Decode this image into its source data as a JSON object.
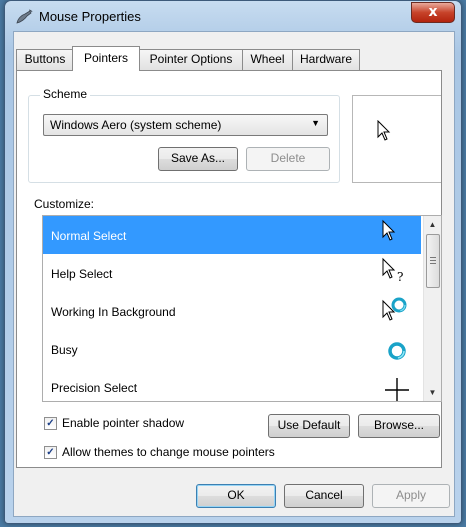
{
  "window": {
    "title": "Mouse Properties",
    "close_glyph": "x"
  },
  "tabs": [
    {
      "label": "Buttons"
    },
    {
      "label": "Pointers"
    },
    {
      "label": "Pointer Options"
    },
    {
      "label": "Wheel"
    },
    {
      "label": "Hardware"
    }
  ],
  "active_tab": "Pointers",
  "scheme": {
    "group_label": "Scheme",
    "selected": "Windows Aero (system scheme)",
    "save_as_label": "Save As...",
    "delete_label": "Delete"
  },
  "customize": {
    "label": "Customize:",
    "items": [
      {
        "label": "Normal Select",
        "icon": "arrow-cursor-icon"
      },
      {
        "label": "Help Select",
        "icon": "help-cursor-icon"
      },
      {
        "label": "Working In Background",
        "icon": "working-cursor-icon"
      },
      {
        "label": "Busy",
        "icon": "busy-ring-icon"
      },
      {
        "label": "Precision Select",
        "icon": "crosshair-cursor-icon"
      }
    ],
    "selected_index": 0
  },
  "options": {
    "pointer_shadow_label": "Enable pointer shadow",
    "pointer_shadow_checked": true,
    "allow_themes_label": "Allow themes to change mouse pointers",
    "allow_themes_checked": true,
    "use_default_label": "Use Default",
    "browse_label": "Browse..."
  },
  "footer": {
    "ok_label": "OK",
    "cancel_label": "Cancel",
    "apply_label": "Apply"
  },
  "colors": {
    "selection": "#3399ff",
    "busy_ring": "#1aa3c8"
  }
}
